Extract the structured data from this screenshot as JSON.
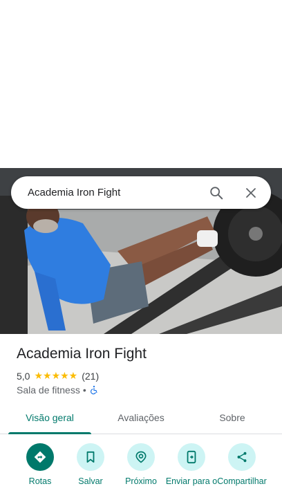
{
  "search": {
    "query": "Academia Iron Fight"
  },
  "place": {
    "name": "Academia Iron Fight",
    "rating": "5,0",
    "stars": "★★★★★",
    "review_count": "(21)",
    "category": "Sala de fitness",
    "separator": "•"
  },
  "tabs": [
    {
      "label": "Visão geral",
      "active": true
    },
    {
      "label": "Avaliações",
      "active": false
    },
    {
      "label": "Sobre",
      "active": false
    }
  ],
  "actions": [
    {
      "label": "Rotas"
    },
    {
      "label": "Salvar"
    },
    {
      "label": "Próximo"
    },
    {
      "label": "Enviar para o"
    },
    {
      "label": "Compartilhar"
    }
  ],
  "colors": {
    "accent": "#00796b",
    "action_bg": "#cdf4f4",
    "stars": "#fbbc04"
  }
}
